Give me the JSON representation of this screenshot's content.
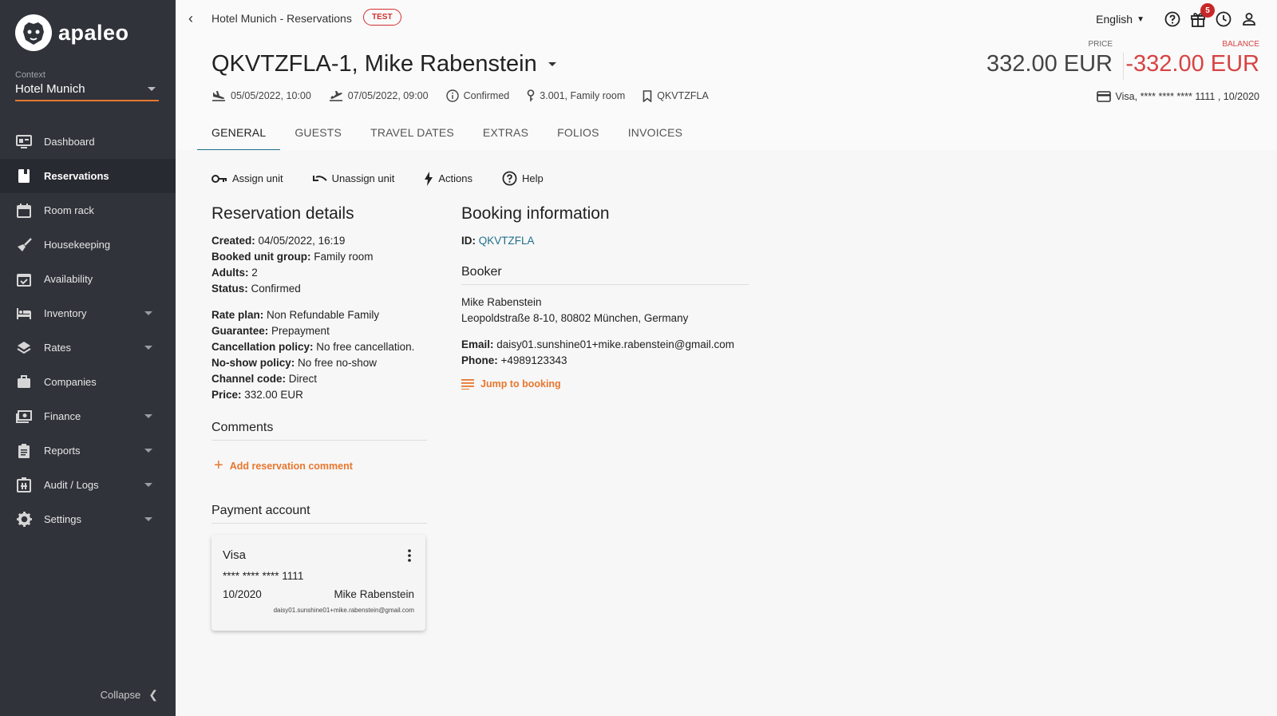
{
  "app": {
    "brand": "apaleo"
  },
  "sidebar": {
    "context_label": "Context",
    "context_value": "Hotel Munich",
    "items": [
      {
        "label": "Dashboard",
        "icon": "dashboard-icon"
      },
      {
        "label": "Reservations",
        "icon": "reservations-icon",
        "active": true
      },
      {
        "label": "Room rack",
        "icon": "calendar-icon"
      },
      {
        "label": "Housekeeping",
        "icon": "broom-icon"
      },
      {
        "label": "Availability",
        "icon": "calendar-check-icon"
      },
      {
        "label": "Inventory",
        "icon": "bed-icon",
        "expandable": true
      },
      {
        "label": "Rates",
        "icon": "layers-icon",
        "expandable": true
      },
      {
        "label": "Companies",
        "icon": "briefcase-icon"
      },
      {
        "label": "Finance",
        "icon": "money-icon",
        "expandable": true
      },
      {
        "label": "Reports",
        "icon": "clipboard-icon",
        "expandable": true
      },
      {
        "label": "Audit / Logs",
        "icon": "audit-icon",
        "expandable": true
      },
      {
        "label": "Settings",
        "icon": "gear-icon",
        "expandable": true
      }
    ],
    "collapse_label": "Collapse"
  },
  "header": {
    "breadcrumb": "Hotel Munich - Reservations",
    "badge": "TEST",
    "language": "English",
    "notifications_count": "5",
    "title": "QKVTZFLA-1, Mike Rabenstein",
    "arrival": "05/05/2022, 10:00",
    "departure": "07/05/2022, 09:00",
    "status": "Confirmed",
    "unit": "3.001,  Family room",
    "booking_id": "QKVTZFLA",
    "price_label": "PRICE",
    "price_value": "332.00 EUR",
    "balance_label": "BALANCE",
    "balance_value": "-332.00 EUR",
    "card_summary": "Visa, **** **** **** 1111 , 10/2020",
    "tabs": [
      "GENERAL",
      "GUESTS",
      "TRAVEL DATES",
      "EXTRAS",
      "FOLIOS",
      "INVOICES"
    ]
  },
  "toolbar": {
    "assign": "Assign unit",
    "unassign": "Unassign unit",
    "actions": "Actions",
    "help": "Help"
  },
  "reservation": {
    "heading": "Reservation details",
    "created_label": "Created:",
    "created": " 04/05/2022, 16:19",
    "unit_group_label": "Booked unit group:",
    "unit_group": " Family room",
    "adults_label": "Adults:",
    "adults": " 2",
    "status_label": "Status:",
    "status": " Confirmed",
    "rate_plan_label": "Rate plan:",
    "rate_plan": " Non Refundable Family",
    "guarantee_label": "Guarantee:",
    "guarantee": " Prepayment",
    "cancellation_label": "Cancellation policy:",
    "cancellation": " No free cancellation.",
    "noshow_label": "No-show policy:",
    "noshow": " No free no-show",
    "channel_label": "Channel code:",
    "channel": " Direct",
    "price_label": "Price:",
    "price": " 332.00 EUR",
    "comments_heading": "Comments",
    "add_comment": "Add reservation comment",
    "payment_heading": "Payment account"
  },
  "payment_card": {
    "brand": "Visa",
    "number": "**** **** **** 1111",
    "expiry": "10/2020",
    "holder": "Mike Rabenstein",
    "email": "daisy01.sunshine01+mike.rabenstein@gmail.com"
  },
  "booking": {
    "heading": "Booking information",
    "id_label": "ID:",
    "id": "QKVTZFLA",
    "booker_heading": "Booker",
    "name": "Mike Rabenstein",
    "address": "Leopoldstraße 8-10, 80802 München, Germany",
    "email_label": "Email:",
    "email": " daisy01.sunshine01+mike.rabenstein@gmail.com",
    "phone_label": "Phone:",
    "phone": " +4989123343",
    "jump": "Jump to booking"
  },
  "colors": {
    "accent": "#e8772e",
    "link": "#1f6f8b",
    "danger": "#d84343",
    "sidebar": "#30333a"
  }
}
